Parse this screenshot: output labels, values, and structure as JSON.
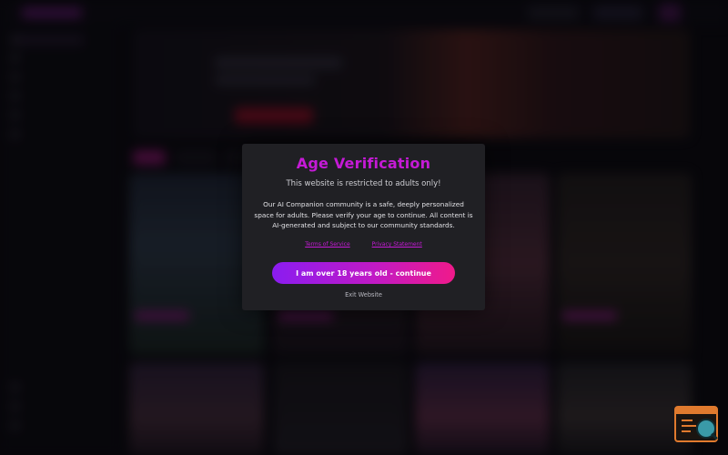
{
  "modal": {
    "title": "Age Verification",
    "subtitle": "This website is restricted to adults only!",
    "body": "Our AI Companion community is a safe, deeply personalized space for adults. Please verify your age to continue. All content is AI-generated and subject to our community standards.",
    "links": {
      "terms": "Terms of Service",
      "privacy": "Privacy Statement"
    },
    "confirm_label": "I am over 18 years old - continue",
    "exit_label": "Exit Website"
  },
  "colors": {
    "accent": "#c51ad6",
    "cta_start": "#8a1cf0",
    "cta_end": "#f01a8a",
    "modal_bg": "#202024",
    "page_bg": "#0b0a10",
    "widget": "#e07a2e"
  },
  "icons": {
    "widget": "app-window-search-icon"
  }
}
